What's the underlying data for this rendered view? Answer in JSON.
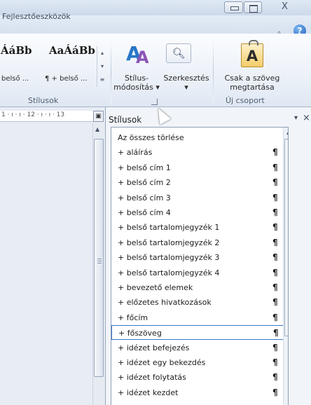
{
  "window": {
    "close_glyph": "X"
  },
  "tabs": {
    "developer": "Fejlesztőeszközök"
  },
  "ribbon": {
    "gallery": {
      "sample1": "ÁáBb",
      "sample2": "AaÁáBb",
      "caption1": "belső ...",
      "caption2": "¶ + belső ..."
    },
    "styles_group_label": "Stílusok",
    "change_styles": {
      "line1": "Stílus-",
      "line2": "módosítás ▾"
    },
    "editing": {
      "label": "Szerkesztés",
      "arrow": "▾"
    },
    "keep_text": {
      "icon_letter": "A",
      "line1": "Csak a szöveg",
      "line2": "megtartása"
    },
    "new_group_label": "Új csoport"
  },
  "ruler": {
    "ticks": "1 · ı · ı · 12 · ı · ı · 13"
  },
  "styles_pane": {
    "title": "Stílusok",
    "dropdown_glyph": "▾",
    "close_glyph": "×",
    "items": [
      {
        "label": "Az összes törlése",
        "mark": ""
      },
      {
        "label": "+ aláírás",
        "mark": "¶"
      },
      {
        "label": "+ belső cím 1",
        "mark": "¶"
      },
      {
        "label": "+ belső cím 2",
        "mark": "¶"
      },
      {
        "label": "+ belső cím 3",
        "mark": "¶"
      },
      {
        "label": "+ belső cím 4",
        "mark": "¶"
      },
      {
        "label": "+ belső tartalomjegyzék 1",
        "mark": "¶"
      },
      {
        "label": "+ belső tartalomjegyzék 2",
        "mark": "¶"
      },
      {
        "label": "+ belső tartalomjegyzék 3",
        "mark": "¶"
      },
      {
        "label": "+ belső tartalomjegyzék 4",
        "mark": "¶"
      },
      {
        "label": "+ bevezető elemek",
        "mark": "¶"
      },
      {
        "label": "+ előzetes hivatkozások",
        "mark": "¶"
      },
      {
        "label": "+ főcím",
        "mark": "¶"
      },
      {
        "label": "+ főszöveg",
        "mark": "¶",
        "selected": true
      },
      {
        "label": "+ idézet befejezés",
        "mark": "¶"
      },
      {
        "label": "+ idézet egy bekezdés",
        "mark": "¶"
      },
      {
        "label": "+ idézet folytatás",
        "mark": "¶"
      },
      {
        "label": "+ idézet kezdet",
        "mark": "¶"
      }
    ]
  }
}
